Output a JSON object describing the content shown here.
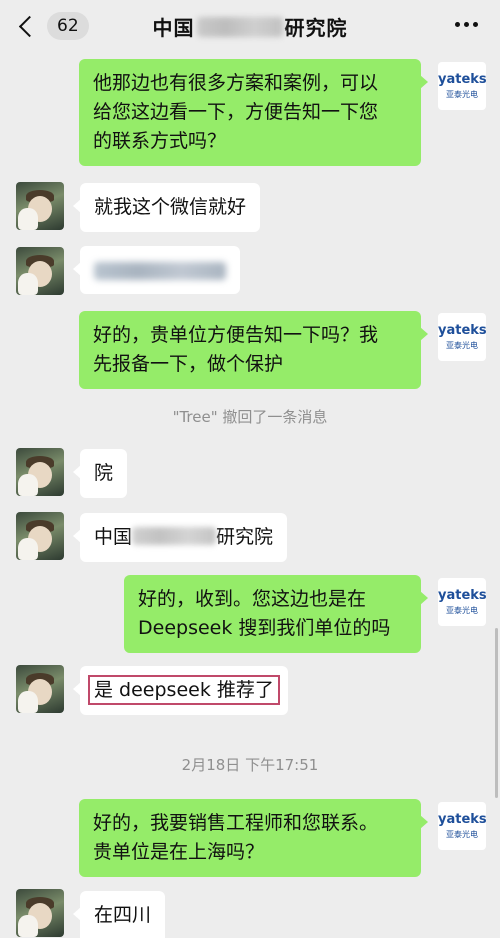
{
  "header": {
    "back_badge": "62",
    "title_prefix": "中国",
    "title_suffix": "研究院"
  },
  "brand": {
    "name": "yateks",
    "subtitle": "亚泰光电"
  },
  "messages": [
    {
      "side": "right",
      "lines": [
        "他那边也有很多方案和案例，可以",
        "给您这边看一下，方便告知一下您",
        "的联系方式吗？"
      ]
    },
    {
      "side": "left",
      "text": "就我这个微信就好"
    },
    {
      "side": "right",
      "lines": [
        "好的，贵单位方便告知一下吗？我",
        "先报备一下，做个保护"
      ]
    },
    {
      "side": "left",
      "text": "院"
    },
    {
      "side": "left",
      "text_prefix": "中国",
      "text_suffix": "研究院"
    },
    {
      "side": "right",
      "lines": [
        "好的，收到。您这边也是在",
        "Deepseek 搜到我们单位的吗"
      ]
    },
    {
      "side": "left",
      "text": "是 deepseek 推荐了"
    },
    {
      "side": "right",
      "lines": [
        "好的，我要销售工程师和您联系。",
        "贵单位是在上海吗？"
      ]
    },
    {
      "side": "left",
      "text": "在四川"
    }
  ],
  "system": {
    "recall_notice": "\"Tree\" 撤回了一条消息",
    "timestamp": "2月18日 下午17:51"
  },
  "colors": {
    "background": "#ededed",
    "bubble_self": "#95ec69",
    "bubble_other": "#ffffff",
    "highlight_border": "#c0496a",
    "brand_blue": "#1e4f9a"
  }
}
